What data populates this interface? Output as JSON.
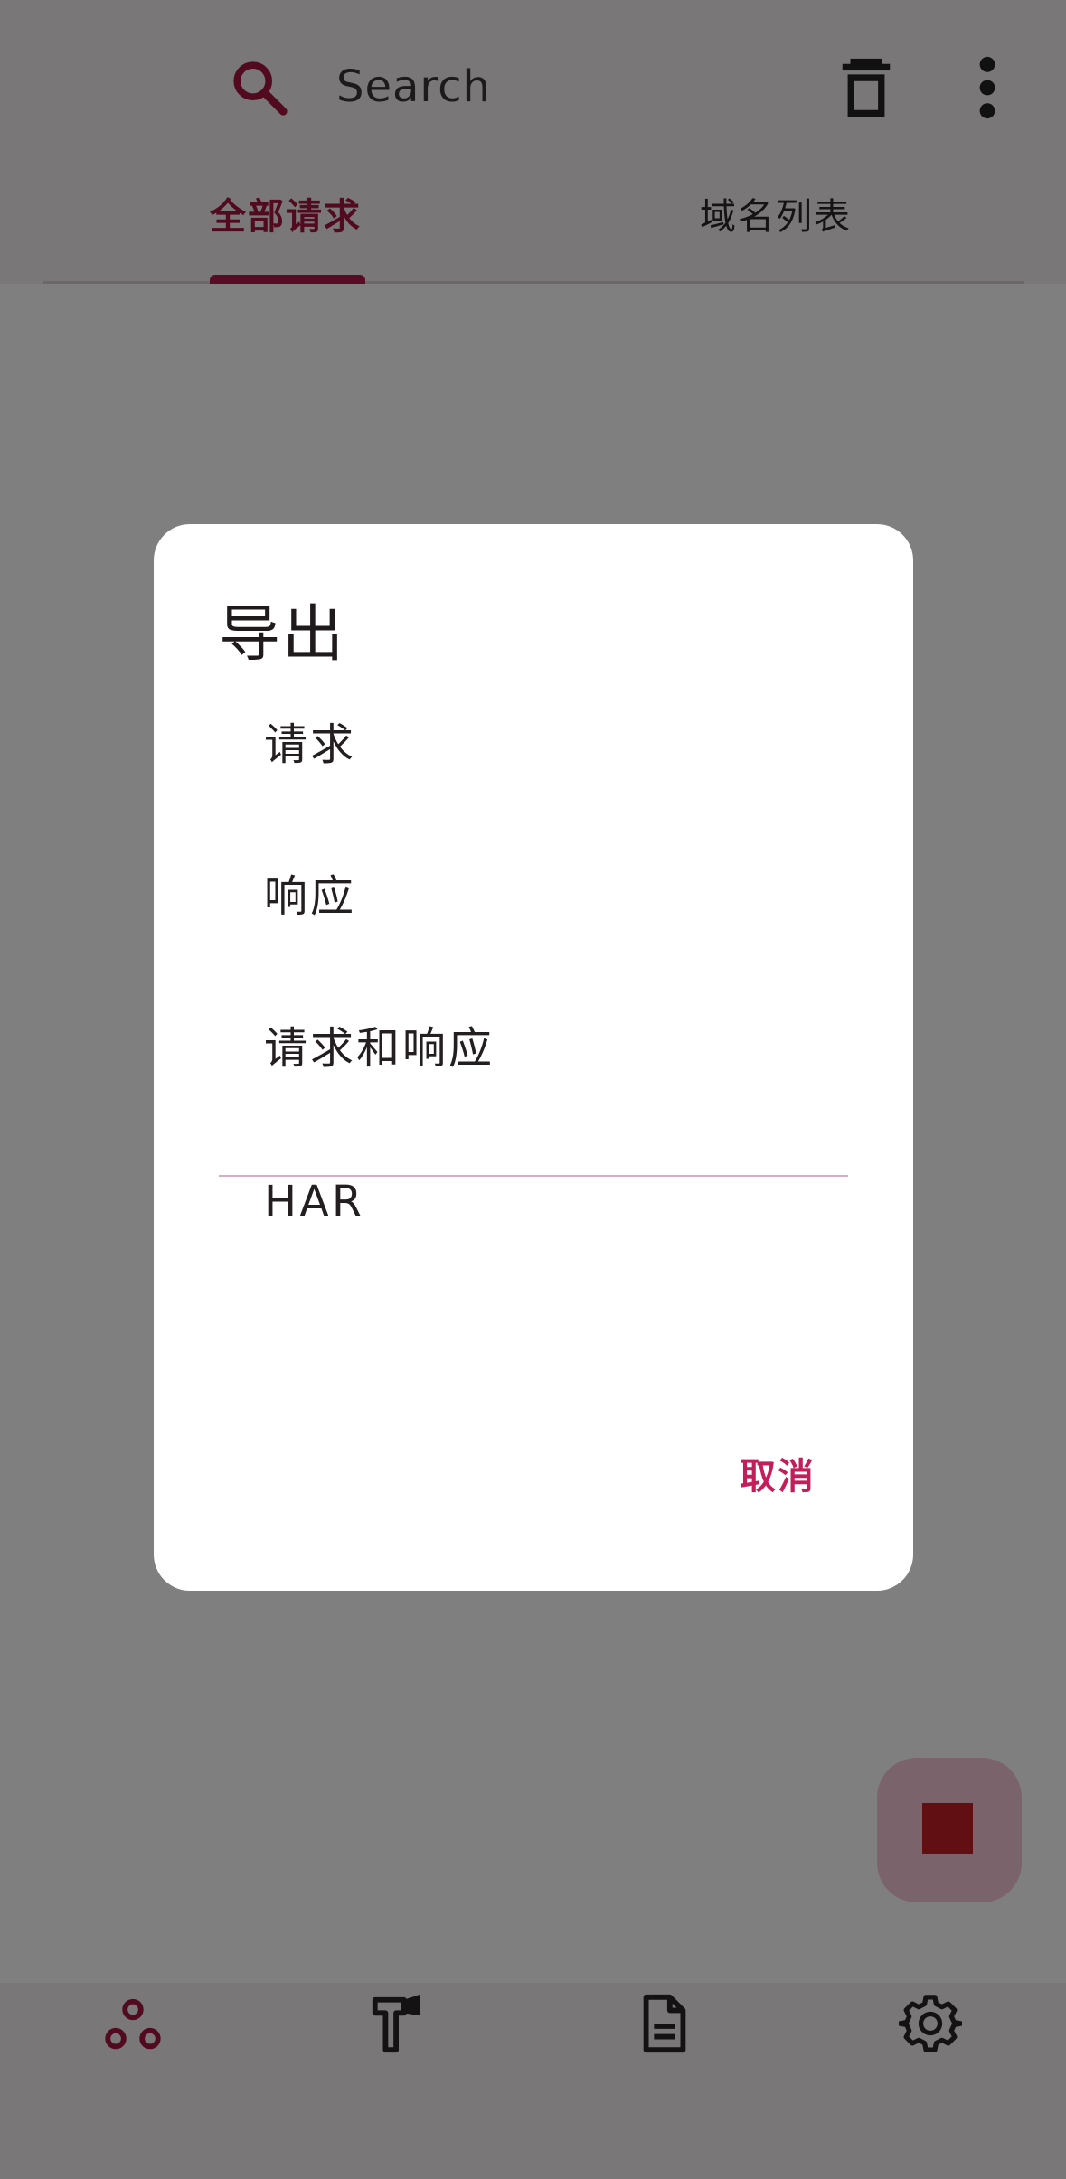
{
  "search": {
    "placeholder": "Search"
  },
  "tabs": [
    {
      "label": "全部请求",
      "selected": true
    },
    {
      "label": "域名列表",
      "selected": false
    }
  ],
  "dialog": {
    "title": "导出",
    "options": [
      {
        "label": "请求"
      },
      {
        "label": "响应"
      },
      {
        "label": "请求和响应"
      },
      {
        "label": "HAR"
      }
    ],
    "cancel_label": "取消"
  },
  "icons": {
    "search": "search-icon",
    "trash": "trash-icon",
    "more": "more-vert-icon",
    "fab": "stop-icon",
    "nav": [
      "network-nodes-icon",
      "hammer-tools-icon",
      "document-icon",
      "gear-icon"
    ]
  },
  "colors": {
    "accent": "#b0174a",
    "accent_text": "#a3143f",
    "cancel": "#c41e5a",
    "fab_bg": "#f4c7d4",
    "fab_stop": "#c51f27",
    "scrim": "rgba(0,0,0,0.5)"
  }
}
